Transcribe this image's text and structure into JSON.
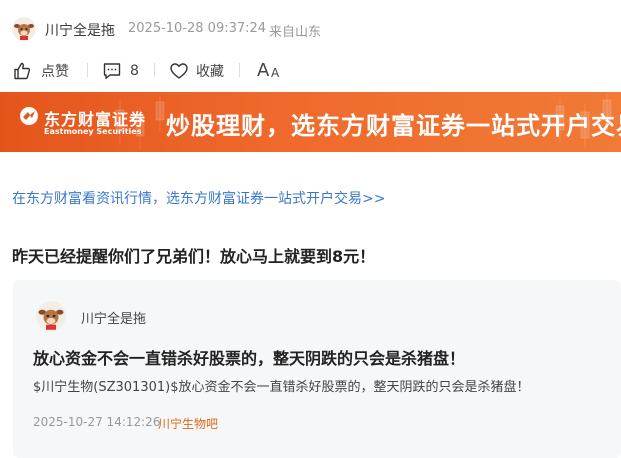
{
  "post": {
    "author": "川宁全是拖",
    "time": "2025-10-28 09:37:24",
    "location": "来自山东"
  },
  "actions": {
    "like_label": "点赞",
    "comment_count": "8",
    "collect_label": "收藏",
    "font_size_label": "AA"
  },
  "banner": {
    "brand_cn": "东方财富证券",
    "brand_en": "Eastmoney Securities",
    "slogan": "炒股理财，选东方财富证券一站式开户交易"
  },
  "promo_link": "在东方财富看资讯行情，选东方财富证券一站式开户交易>>",
  "post_text": "昨天已经提醒你们了兄弟们！放心马上就要到8元！",
  "quoted": {
    "author": "川宁全是拖",
    "title": "放心资金不会一直错杀好股票的，整天阴跌的只会是杀猪盘！",
    "body": "$川宁生物(SZ301301)$放心资金不会一直错杀好股票的，整天阴跌的只会是杀猪盘！",
    "time": "2025-10-27 14:12:26",
    "bar": "川宁生物吧"
  },
  "colors": {
    "link": "#3a78c9",
    "banner": "#ea5d22",
    "bar_link": "#e06a14"
  }
}
